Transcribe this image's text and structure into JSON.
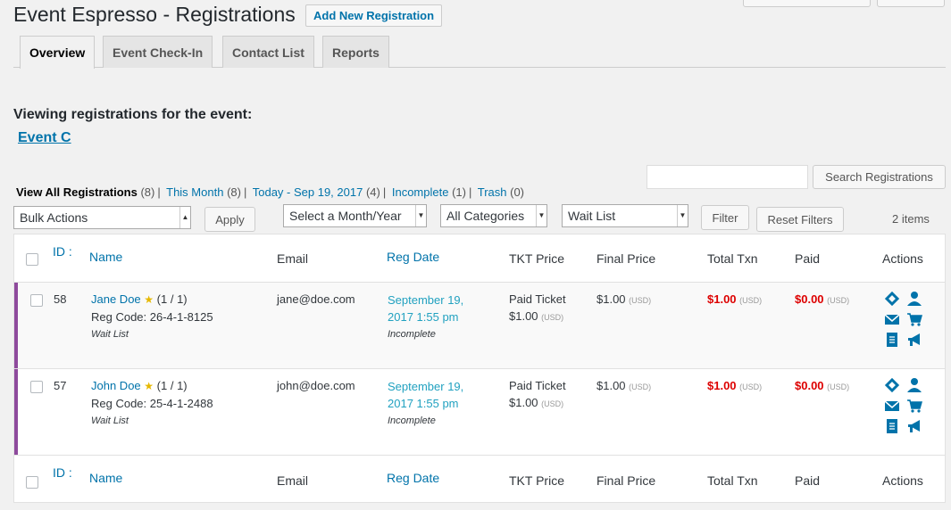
{
  "header": {
    "title": "Event Espresso - Registrations",
    "add_new": "Add New Registration"
  },
  "tabs": [
    {
      "label": "Overview",
      "active": true
    },
    {
      "label": "Event Check-In",
      "active": false
    },
    {
      "label": "Contact List",
      "active": false
    },
    {
      "label": "Reports",
      "active": false
    }
  ],
  "event": {
    "viewing_label": "Viewing registrations for the event:",
    "name": "Event C"
  },
  "search": {
    "button": "Search Registrations",
    "value": ""
  },
  "views": [
    {
      "label": "View All Registrations",
      "count": "(8)",
      "current": true
    },
    {
      "label": "This Month",
      "count": "(8)"
    },
    {
      "label": "Today - Sep 19, 2017",
      "count": "(4)"
    },
    {
      "label": "Incomplete",
      "count": "(1)"
    },
    {
      "label": "Trash",
      "count": "(0)"
    }
  ],
  "filters": {
    "bulk_actions": "Bulk Actions",
    "apply": "Apply",
    "month": "Select a Month/Year",
    "categories": "All Categories",
    "status": "Wait List",
    "filter": "Filter",
    "reset": "Reset Filters",
    "items": "2 items"
  },
  "columns": {
    "id": "ID",
    "name": "Name",
    "email": "Email",
    "reg_date": "Reg Date",
    "tkt_price": "TKT Price",
    "final_price": "Final Price",
    "total_txn": "Total Txn",
    "paid": "Paid",
    "actions": "Actions"
  },
  "rows": [
    {
      "id": "58",
      "name": "Jane Doe",
      "count": "(1 / 1)",
      "reg_code": "Reg Code: 26-4-1-8125",
      "status": "Wait List",
      "email": "jane@doe.com",
      "date_line1": "September 19,",
      "date_line2": "2017 1:55 pm",
      "txn_status": "Incomplete",
      "ticket_name": "Paid Ticket",
      "ticket_price": "$1.00",
      "final_price": "$1.00",
      "total_txn": "$1.00",
      "paid": "$0.00",
      "currency": "(USD)"
    },
    {
      "id": "57",
      "name": "John Doe",
      "count": "(1 / 1)",
      "reg_code": "Reg Code: 25-4-1-2488",
      "status": "Wait List",
      "email": "john@doe.com",
      "date_line1": "September 19,",
      "date_line2": "2017 1:55 pm",
      "txn_status": "Incomplete",
      "ticket_name": "Paid Ticket",
      "ticket_price": "$1.00",
      "final_price": "$1.00",
      "total_txn": "$1.00",
      "paid": "$0.00",
      "currency": "(USD)"
    }
  ],
  "colors": {
    "link": "#0073aa",
    "date": "#21a1c0",
    "alert": "#dd0000",
    "status_bar": "#8e4a9c",
    "icon": "#0073aa"
  }
}
